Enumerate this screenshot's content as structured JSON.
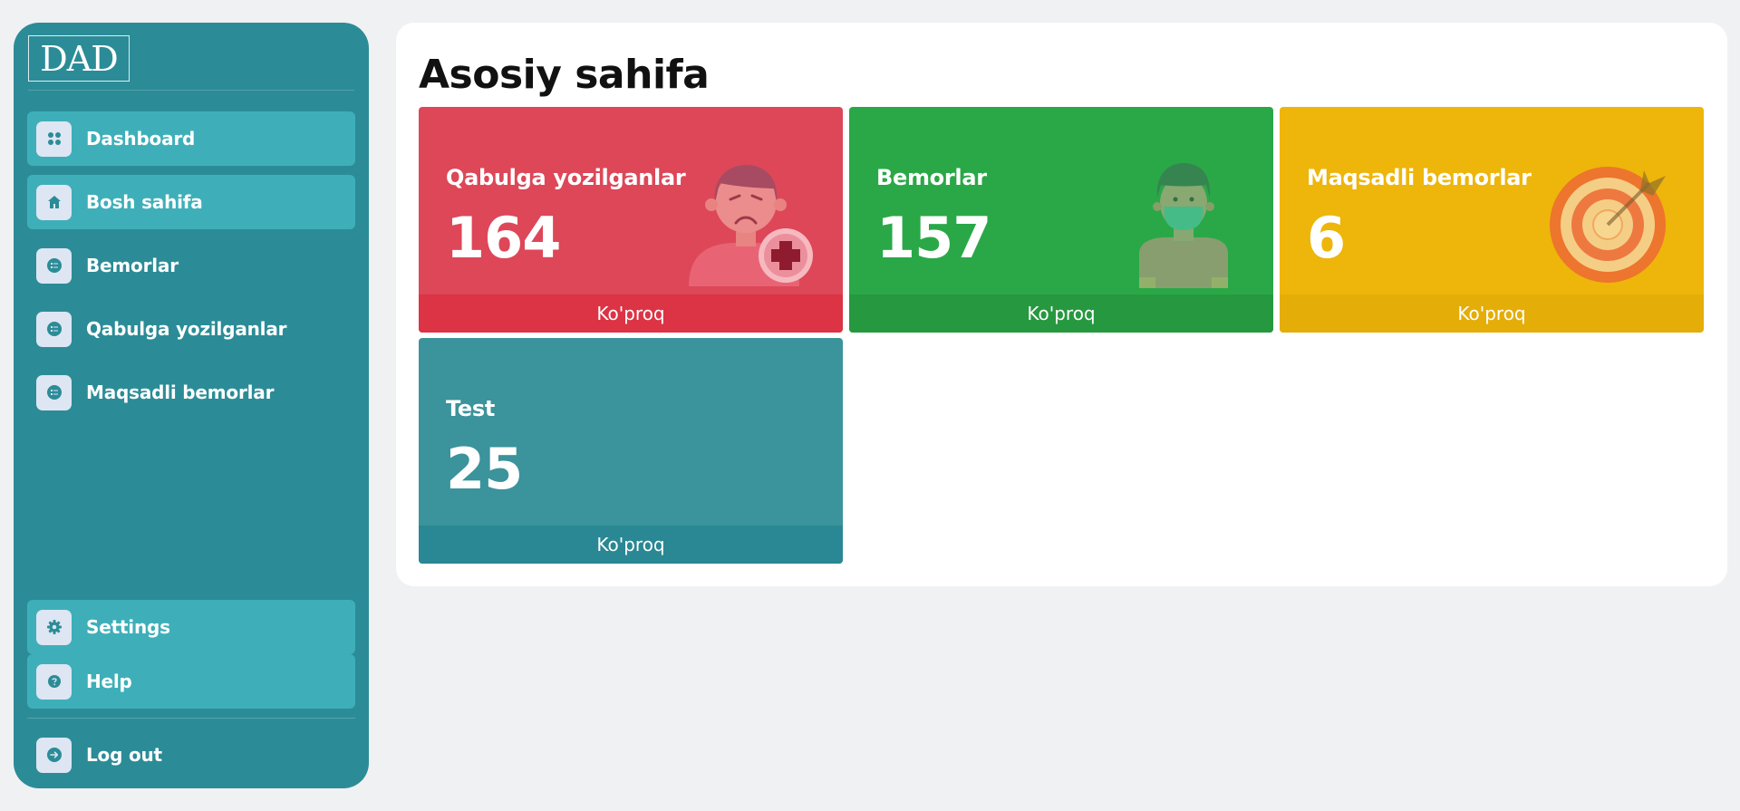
{
  "sidebar": {
    "logo_text": "DAD",
    "items": [
      {
        "label": "Dashboard",
        "icon": "grid-icon",
        "active": true
      },
      {
        "label": "Bosh sahifa",
        "icon": "home-icon",
        "active": true
      },
      {
        "label": "Bemorlar",
        "icon": "list-icon",
        "active": false
      },
      {
        "label": "Qabulga yozilganlar",
        "icon": "list-icon",
        "active": false
      },
      {
        "label": "Maqsadli bemorlar",
        "icon": "list-icon",
        "active": false
      }
    ],
    "bottom_items": [
      {
        "label": "Settings",
        "icon": "gear-icon",
        "active": true
      },
      {
        "label": "Help",
        "icon": "help-icon",
        "active": true
      }
    ],
    "logout_label": "Log out"
  },
  "main": {
    "title": "Asosiy sahifa",
    "cards": [
      {
        "title": "Qabulga yozilganlar",
        "value": "164",
        "footer": "Ko'proq",
        "color": "#dd4758",
        "footer_color": "#dc3345",
        "illustration": "sick-patient-icon"
      },
      {
        "title": "Bemorlar",
        "value": "157",
        "footer": "Ko'proq",
        "color": "#2aa847",
        "footer_color": "#26983f",
        "illustration": "masked-patient-icon"
      },
      {
        "title": "Maqsadli bemorlar",
        "value": "6",
        "footer": "Ko'proq",
        "color": "#eeb50a",
        "footer_color": "#e4ad08",
        "illustration": "target-icon"
      },
      {
        "title": "Test",
        "value": "25",
        "footer": "Ko'proq",
        "color": "#3b939b",
        "footer_color": "#298893",
        "illustration": ""
      }
    ]
  }
}
